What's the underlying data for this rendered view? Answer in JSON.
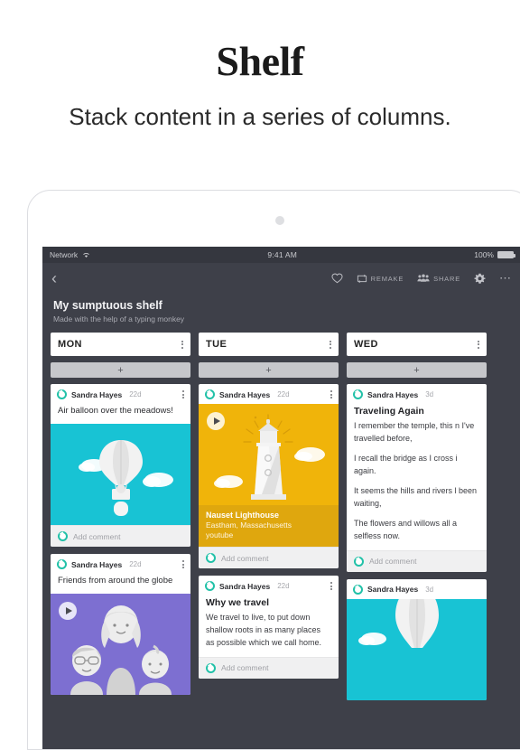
{
  "promo": {
    "title": "Shelf",
    "subtitle": "Stack content in a series of columns."
  },
  "device": {
    "status_bar": {
      "carrier": "Network",
      "wifi_icon": "wifi-icon",
      "time": "9:41 AM",
      "battery_percent": "100%",
      "battery_icon": "battery-full-icon"
    },
    "toolbar": {
      "back_icon": "chevron-left-icon",
      "like_icon": "heart-outline-icon",
      "remake_icon": "repeat-icon",
      "remake_label": "REMAKE",
      "share_icon": "people-icon",
      "share_label": "SHARE",
      "settings_icon": "gear-icon",
      "more_icon": "ellipsis-icon"
    }
  },
  "shelf": {
    "title": "My sumptuous shelf",
    "subtitle": "Made with the help of a typing monkey"
  },
  "add_button_label": "+",
  "comment_placeholder": "Add comment",
  "columns": [
    {
      "name": "MON",
      "cards": [
        {
          "author": "Sandra Hayes",
          "age": "22d",
          "text": "Air balloon over the meadows!",
          "media": "hot-air-balloon-illustration",
          "media_color": "#18c3d4",
          "has_play": false
        },
        {
          "author": "Sandra Hayes",
          "age": "22d",
          "text": "Friends from around the globe",
          "media": "three-friends-illustration",
          "media_color": "#7d6fd1",
          "has_play": true
        }
      ]
    },
    {
      "name": "TUE",
      "cards": [
        {
          "author": "Sandra Hayes",
          "age": "22d",
          "media": "lighthouse-illustration",
          "media_color": "#f0b40a",
          "has_play": true,
          "caption_title": "Nauset Lighthouse",
          "caption_place": "Eastham, Massachusetts",
          "caption_source": "youtube"
        },
        {
          "author": "Sandra Hayes",
          "age": "22d",
          "heading": "Why we travel",
          "body": "We travel to live, to put down shallow roots in as many places as possible which we call home."
        }
      ]
    },
    {
      "name": "WED",
      "cards": [
        {
          "author": "Sandra Hayes",
          "age": "3d",
          "heading": "Traveling Again",
          "paragraphs": [
            "I remember the temple, this n I've travelled before,",
            "I recall the bridge as I cross i again.",
            "It seems the hills and rivers l been waiting,",
            "The flowers and willows all a selfless now."
          ]
        },
        {
          "author": "Sandra Hayes",
          "age": "3d",
          "media": "hot-air-balloon-illustration",
          "media_color": "#18c3d4",
          "has_play": false
        }
      ]
    }
  ]
}
